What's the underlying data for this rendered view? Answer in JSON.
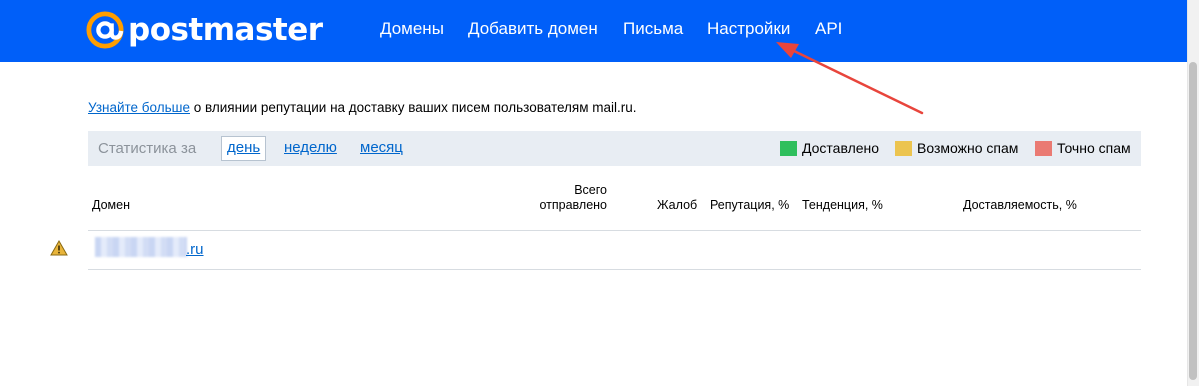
{
  "header": {
    "brand": "postmaster",
    "nav": [
      {
        "label": "Домены"
      },
      {
        "label": "Добавить домен"
      },
      {
        "label": "Письма"
      },
      {
        "label": "Настройки"
      },
      {
        "label": "API"
      }
    ]
  },
  "info": {
    "link": "Узнайте больше",
    "text": " о влиянии репутации на доставку ваших писем пользователям mail.ru."
  },
  "stats": {
    "label": "Статистика за",
    "periods": [
      "день",
      "неделю",
      "месяц"
    ],
    "active_period": "день",
    "legend": [
      {
        "label": "Доставлено",
        "color": "#2fbf5d"
      },
      {
        "label": "Возможно спам",
        "color": "#ecc44f"
      },
      {
        "label": "Точно спам",
        "color": "#ea7a73"
      }
    ]
  },
  "table": {
    "headers": {
      "domain": "Домен",
      "sent_line1": "Всего",
      "sent_line2": "отправлено",
      "complaints": "Жалоб",
      "reputation": "Репутация, %",
      "trend": "Тенденция, %",
      "deliverability": "Доставляемость, %"
    },
    "rows": [
      {
        "domain_suffix": ".ru",
        "warning": true
      }
    ]
  },
  "colors": {
    "header_bg": "#005ff9",
    "link": "#0066cc",
    "annotation_arrow": "#e8453c"
  },
  "icons": {
    "logo": "at-sign-icon",
    "warning": "warning-icon"
  }
}
